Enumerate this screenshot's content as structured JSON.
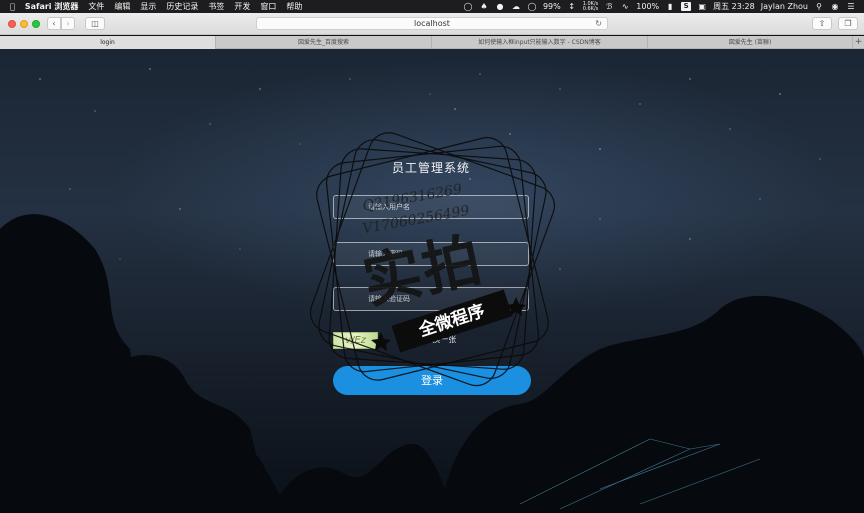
{
  "menubar": {
    "apple_icon": "apple-icon",
    "app_name": "Safari 浏览器",
    "menus": [
      "文件",
      "编辑",
      "显示",
      "历史记录",
      "书签",
      "开发",
      "窗口",
      "帮助"
    ],
    "battery_pct": "99%",
    "net_up": "1.0K/s",
    "net_down": "0.6K/s",
    "wifi_pct": "100%",
    "clock": "周五 23:28",
    "user": "Jaylan Zhou"
  },
  "browser": {
    "url": "localhost",
    "tabs": [
      "login",
      "図爱先生_百度搜索",
      "如何使输入框input只能输入数字 - CSDN博客",
      "図爱先生 (苗聯)"
    ],
    "active_tab": 0
  },
  "login": {
    "title": "员工管理系统",
    "username_placeholder": "请输入用户名",
    "password_placeholder": "请输入密码",
    "captcha_placeholder": "请输入验证码",
    "captcha_image_text": "v/Ez",
    "captcha_refresh": "看不清?换一张",
    "submit": "登录"
  },
  "watermark": {
    "line1": "Q2196316269",
    "line2": "V17060256499",
    "big": "实拍",
    "ribbon": "全微程序"
  },
  "colors": {
    "button": "#1b8fe0",
    "menubar": "#1d1d1f",
    "sky_top": "#1b2634",
    "sky_bottom": "#0a1017"
  }
}
